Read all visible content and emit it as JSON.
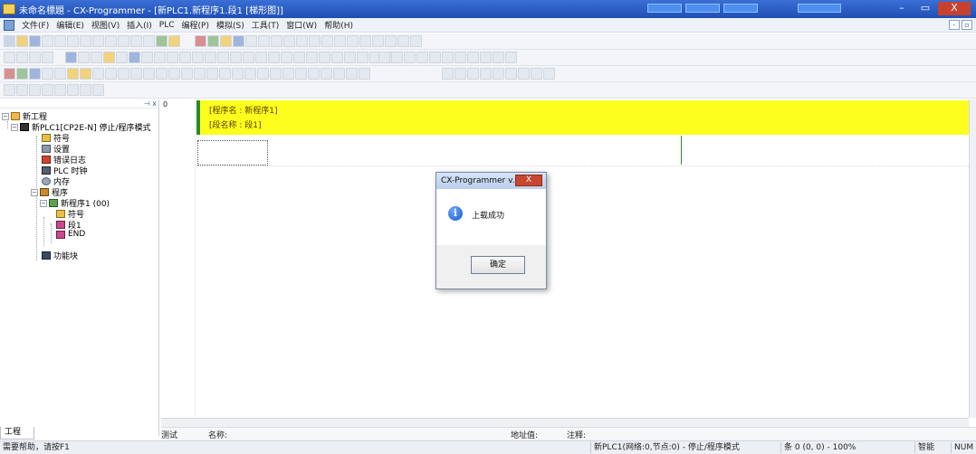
{
  "window": {
    "title": "未命名標題 - CX-Programmer - [新PLC1.新程序1.段1 [梯形图]]",
    "controls": {
      "minimize": "–",
      "restore": "▭",
      "close": "X"
    }
  },
  "menubar": {
    "items": [
      "文件(F)",
      "编辑(E)",
      "视图(V)",
      "插入(I)",
      "PLC",
      "编程(P)",
      "模拟(S)",
      "工具(T)",
      "窗口(W)",
      "帮助(H)"
    ],
    "mdi_controls": {
      "minimize": "-",
      "restore": "▫"
    }
  },
  "project_tree": {
    "items": [
      {
        "label": "新工程",
        "icon": "project-icon"
      },
      {
        "label": "新PLC1[CP2E-N] 停止/程序模式",
        "icon": "plc-icon"
      },
      {
        "label": "符号",
        "icon": "symbols-icon"
      },
      {
        "label": "设置",
        "icon": "settings-icon"
      },
      {
        "label": "错误日志",
        "icon": "error-log-icon"
      },
      {
        "label": "PLC 时钟",
        "icon": "clock-icon"
      },
      {
        "label": "内存",
        "icon": "memory-icon"
      },
      {
        "label": "程序",
        "icon": "programs-icon"
      },
      {
        "label": "新程序1 (00)",
        "icon": "program-icon"
      },
      {
        "label": "符号",
        "icon": "symbols-icon"
      },
      {
        "label": "段1",
        "icon": "section-icon"
      },
      {
        "label": "END",
        "icon": "section-icon"
      },
      {
        "label": "功能块",
        "icon": "function-block-icon"
      }
    ],
    "tab_label": "工程",
    "close_label": "⊣ x"
  },
  "ladder": {
    "rung_number": "0",
    "program_name_line": "[程序名 : 新程序1]",
    "section_name_line": "[段名称 : 段1]"
  },
  "info_strip": {
    "col_label": "测试",
    "name_label": "名称:",
    "address_label": "地址值:",
    "comment_label": "注释:"
  },
  "statusbar": {
    "help": "需要帮助，请按F1",
    "location": "新PLC1(网络:0,节点:0) - 停止/程序模式",
    "cursor": "条 0 (0, 0)  - 100%",
    "mode": "智能",
    "num": "NUM"
  },
  "dialog": {
    "title": "CX-Programmer v...",
    "close": "X",
    "message": "上载成功",
    "ok_label": "确定",
    "icon": "info-icon"
  }
}
